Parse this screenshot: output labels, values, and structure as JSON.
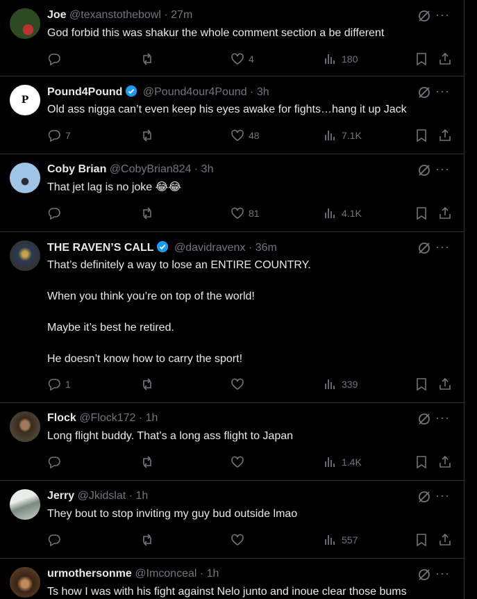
{
  "posts": [
    {
      "name": "Joe",
      "handle": "@texanstothebowl",
      "dot": "·",
      "time": "27m",
      "verified": false,
      "lines": [
        "God forbid this was shakur the whole comment section a be different"
      ],
      "replies": "",
      "reposts": "",
      "likes": "4",
      "views": "180",
      "avatar_color": "#3a5a2a"
    },
    {
      "name": "Pound4Pound",
      "handle": "@Pound4our4Pound",
      "dot": "·",
      "time": "3h",
      "verified": true,
      "lines": [
        "Old ass nigga can’t even keep his eyes awake for fights…hang it up Jack"
      ],
      "replies": "7",
      "reposts": "",
      "likes": "48",
      "views": "7.1K",
      "avatar_color": "#ffffff"
    },
    {
      "name": "Coby Brian",
      "handle": "@CobyBrian824",
      "dot": "·",
      "time": "3h",
      "verified": false,
      "lines": [
        "That jet lag is no joke"
      ],
      "emoji": "😂😂",
      "replies": "",
      "reposts": "",
      "likes": "81",
      "views": "4.1K",
      "avatar_color": "#9fc4e6"
    },
    {
      "name": "THE RAVEN’S CALL",
      "handle": "@davidravenx",
      "dot": "·",
      "time": "36m",
      "verified": true,
      "lines": [
        "That’s definitely a way to lose an ENTIRE COUNTRY.",
        "When you think you’re on top of the world!",
        "Maybe it’s best he retired.",
        "He doesn’t know how to carry the sport!"
      ],
      "replies": "1",
      "reposts": "",
      "likes": "",
      "views": "339",
      "avatar_color": "#4a5a6e"
    },
    {
      "name": "Flock",
      "handle": "@Flock172",
      "dot": "·",
      "time": "1h",
      "verified": false,
      "lines": [
        "Long flight buddy. That’s a long ass flight to Japan"
      ],
      "replies": "",
      "reposts": "",
      "likes": "",
      "views": "1.4K",
      "avatar_color": "#5a4a3a"
    },
    {
      "name": "Jerry",
      "handle": "@Jkidslat",
      "dot": "·",
      "time": "1h",
      "verified": false,
      "lines": [
        "They bout to stop inviting my guy bud outside lmao"
      ],
      "replies": "",
      "reposts": "",
      "likes": "",
      "views": "557",
      "avatar_color": "#c8d0cc"
    },
    {
      "name": "urmothersonme",
      "handle": "@Imconceal",
      "dot": "·",
      "time": "1h",
      "verified": false,
      "lines": [
        "Ts how I was with his fight against Nelo junto and inoue clear those bums"
      ],
      "replies": "",
      "reposts": "",
      "likes": "",
      "views": "",
      "avatar_color": "#6a4a30"
    }
  ],
  "colors": {
    "background": "#000000",
    "text": "#e7e9ea",
    "muted": "#71767b",
    "border": "#2f3336",
    "verified": "#1d9bf0"
  },
  "icons": {
    "reply": "reply-icon",
    "repost": "repost-icon",
    "like": "heart-icon",
    "views": "views-icon",
    "bookmark": "bookmark-icon",
    "share": "share-icon",
    "grok": "grok-icon",
    "more": "more-icon"
  }
}
